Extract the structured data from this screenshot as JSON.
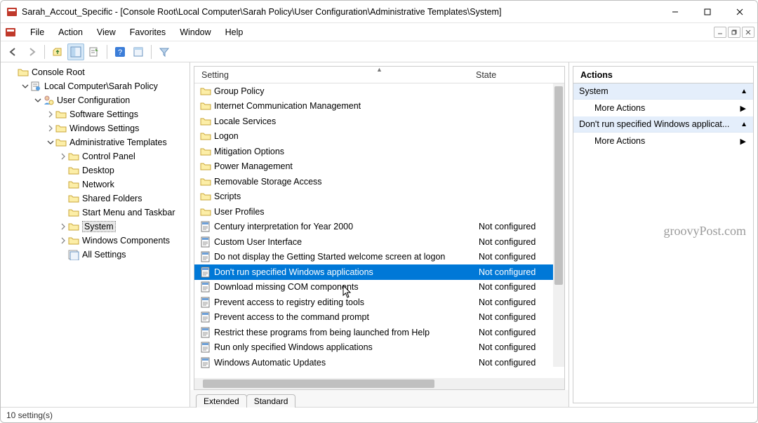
{
  "window_title": "Sarah_Accout_Specific - [Console Root\\Local Computer\\Sarah Policy\\User Configuration\\Administrative Templates\\System]",
  "menu": [
    "File",
    "Action",
    "View",
    "Favorites",
    "Window",
    "Help"
  ],
  "tree": [
    {
      "indent": 0,
      "chev": "",
      "icon": "console",
      "label": "Console Root"
    },
    {
      "indent": 1,
      "chev": "down",
      "icon": "policy",
      "label": "Local Computer\\Sarah Policy"
    },
    {
      "indent": 2,
      "chev": "down",
      "icon": "user",
      "label": "User Configuration"
    },
    {
      "indent": 3,
      "chev": "right",
      "icon": "folder",
      "label": "Software Settings"
    },
    {
      "indent": 3,
      "chev": "right",
      "icon": "folder",
      "label": "Windows Settings"
    },
    {
      "indent": 3,
      "chev": "down",
      "icon": "folder",
      "label": "Administrative Templates"
    },
    {
      "indent": 4,
      "chev": "right",
      "icon": "folder",
      "label": "Control Panel"
    },
    {
      "indent": 4,
      "chev": "",
      "icon": "folder",
      "label": "Desktop"
    },
    {
      "indent": 4,
      "chev": "",
      "icon": "folder",
      "label": "Network"
    },
    {
      "indent": 4,
      "chev": "",
      "icon": "folder",
      "label": "Shared Folders"
    },
    {
      "indent": 4,
      "chev": "",
      "icon": "folder",
      "label": "Start Menu and Taskbar"
    },
    {
      "indent": 4,
      "chev": "right",
      "icon": "folder",
      "label": "System",
      "selected": true
    },
    {
      "indent": 4,
      "chev": "right",
      "icon": "folder",
      "label": "Windows Components"
    },
    {
      "indent": 4,
      "chev": "",
      "icon": "allsettings",
      "label": "All Settings"
    }
  ],
  "columns": {
    "setting": "Setting",
    "state": "State"
  },
  "rows": [
    {
      "icon": "folder",
      "label": "Group Policy",
      "state": ""
    },
    {
      "icon": "folder",
      "label": "Internet Communication Management",
      "state": ""
    },
    {
      "icon": "folder",
      "label": "Locale Services",
      "state": ""
    },
    {
      "icon": "folder",
      "label": "Logon",
      "state": ""
    },
    {
      "icon": "folder",
      "label": "Mitigation Options",
      "state": ""
    },
    {
      "icon": "folder",
      "label": "Power Management",
      "state": ""
    },
    {
      "icon": "folder",
      "label": "Removable Storage Access",
      "state": ""
    },
    {
      "icon": "folder",
      "label": "Scripts",
      "state": ""
    },
    {
      "icon": "folder",
      "label": "User Profiles",
      "state": ""
    },
    {
      "icon": "setting",
      "label": "Century interpretation for Year 2000",
      "state": "Not configured"
    },
    {
      "icon": "setting",
      "label": "Custom User Interface",
      "state": "Not configured"
    },
    {
      "icon": "setting",
      "label": "Do not display the Getting Started welcome screen at logon",
      "state": "Not configured"
    },
    {
      "icon": "setting",
      "label": "Don't run specified Windows applications",
      "state": "Not configured",
      "selected": true
    },
    {
      "icon": "setting",
      "label": "Download missing COM components",
      "state": "Not configured"
    },
    {
      "icon": "setting",
      "label": "Prevent access to registry editing tools",
      "state": "Not configured"
    },
    {
      "icon": "setting",
      "label": "Prevent access to the command prompt",
      "state": "Not configured"
    },
    {
      "icon": "setting",
      "label": "Restrict these programs from being launched from Help",
      "state": "Not configured"
    },
    {
      "icon": "setting",
      "label": "Run only specified Windows applications",
      "state": "Not configured"
    },
    {
      "icon": "setting",
      "label": "Windows Automatic Updates",
      "state": "Not configured"
    }
  ],
  "tabs": [
    "Extended",
    "Standard"
  ],
  "actions": {
    "title": "Actions",
    "groups": [
      {
        "header": "System",
        "items": [
          "More Actions"
        ]
      },
      {
        "header": "Don't run specified Windows applicat...",
        "items": [
          "More Actions"
        ]
      }
    ]
  },
  "watermark": "groovyPost.com",
  "status": "10 setting(s)"
}
